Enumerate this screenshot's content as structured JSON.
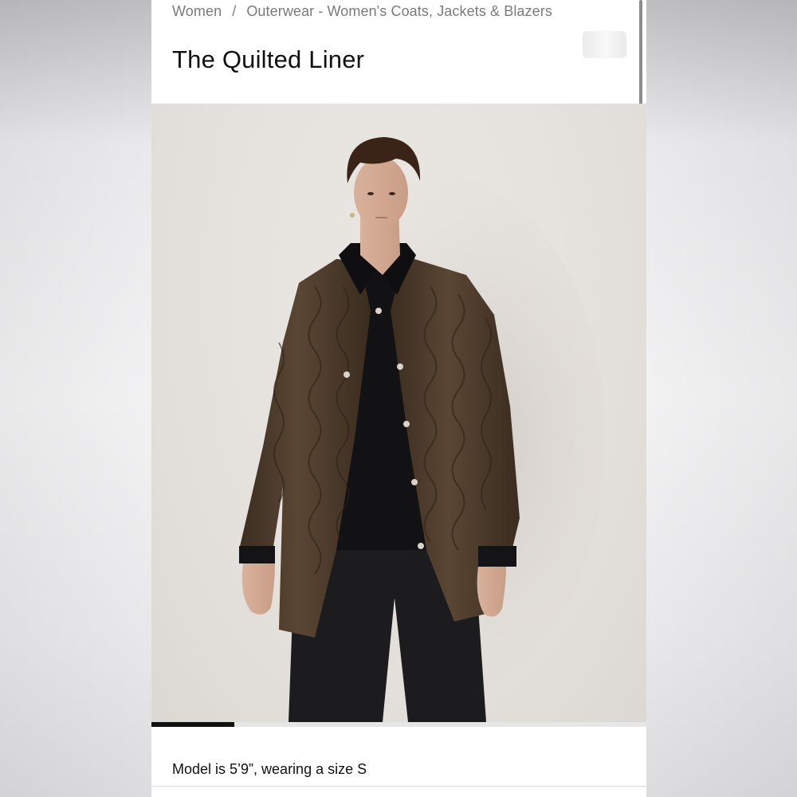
{
  "breadcrumb": {
    "items": [
      "Women",
      "Outerwear - Women's Coats, Jackets & Blazers"
    ],
    "separator": "/"
  },
  "product": {
    "title": "The Quilted Liner",
    "image_subject": "model wearing brown quilted liner jacket over black knit and trousers"
  },
  "gallery": {
    "progress_fraction": 0.167
  },
  "caption": "Model is 5’9”, wearing a size S",
  "colors": {
    "jacket": "#4a3a2a",
    "background": "#e4e0dc",
    "progress": "#111111"
  }
}
